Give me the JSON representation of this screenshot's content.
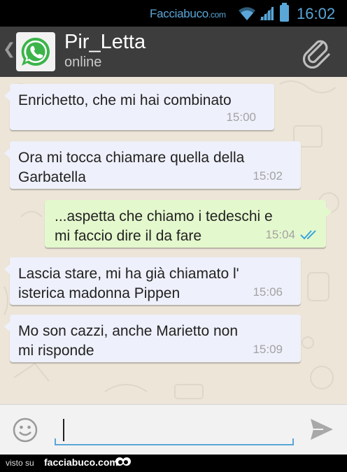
{
  "status_bar": {
    "brand": "Facciabuco",
    "brand_suffix": ".com",
    "time": "16:02",
    "accent_color": "#5aa6d8"
  },
  "header": {
    "back_icon": "chevron-left-icon",
    "avatar_icon": "whatsapp-icon",
    "contact_name": "Pir_Letta",
    "contact_status": "online",
    "attach_icon": "paperclip-icon"
  },
  "messages": [
    {
      "direction": "in",
      "text": "Enrichetto, che mi hai combinato",
      "time": "15:00"
    },
    {
      "direction": "in",
      "text": "Ora mi tocca chiamare quella della\nGarbatella",
      "time": "15:02"
    },
    {
      "direction": "out",
      "text": "...aspetta che chiamo i tedeschi e\nmi faccio dire il da fare",
      "time": "15:04",
      "status": "read-double-check"
    },
    {
      "direction": "in",
      "text": "Lascia stare, mi ha già chiamato l'\nisterica madonna Pippen",
      "time": "15:06"
    },
    {
      "direction": "in",
      "text": "Mo son cazzi, anche Marietto non\nmi risponde",
      "time": "15:09"
    }
  ],
  "composer": {
    "emoji_icon": "smiley-icon",
    "value": "",
    "send_icon": "send-icon"
  },
  "footer": {
    "visto_su": "visto su",
    "site": "facciabuco.com"
  },
  "colors": {
    "incoming_bubble": "#eef0fb",
    "outgoing_bubble": "#e4f8cd",
    "chat_background": "#ece5d8",
    "action_bar": "#3d3d3d",
    "read_ticks": "#3aa6dc"
  }
}
